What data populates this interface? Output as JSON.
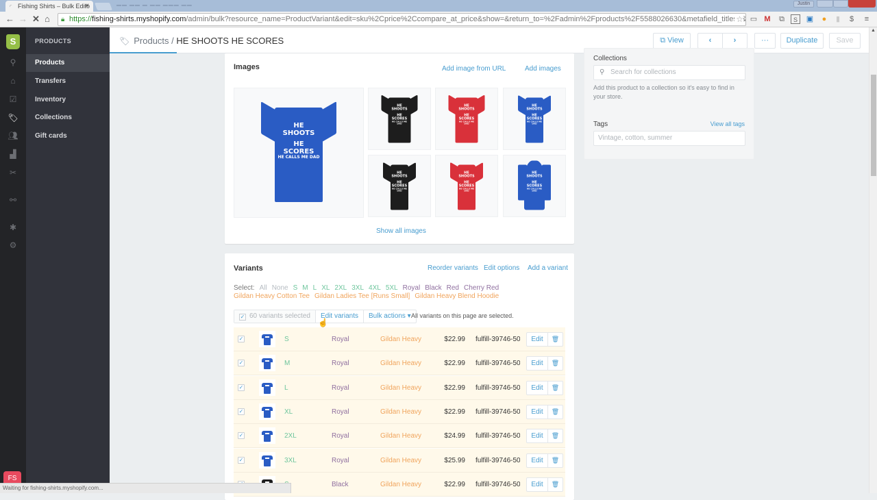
{
  "browser": {
    "tab_title": "Fishing Shirts – Bulk Edito",
    "url_scheme": "https://",
    "url_host": "fishing-shirts.myshopify.com",
    "url_path": "/admin/bulk?resource_name=ProductVariant&edit=sku%2Cprice%2Ccompare_at_price&show=&return_to=%2Fadmin%2Fproducts%2F5588026630&metafield_titles=&m",
    "user_button": "Justin",
    "status_text": "Waiting for fishing-shirts.myshopify.com..."
  },
  "rail": {
    "store_badge": "FS",
    "logo_letter": "S"
  },
  "subnav": {
    "heading": "PRODUCTS",
    "items": [
      {
        "label": "Products",
        "active": true
      },
      {
        "label": "Transfers",
        "active": false
      },
      {
        "label": "Inventory",
        "active": false
      },
      {
        "label": "Collections",
        "active": false
      },
      {
        "label": "Gift cards",
        "active": false
      }
    ]
  },
  "header": {
    "breadcrumb_parent": "Products",
    "separator": " / ",
    "title": "HE SHOOTS HE SCORES",
    "view_label": "View",
    "prev_label": "‹",
    "next_label": "›",
    "more_label": "···",
    "duplicate_label": "Duplicate",
    "save_label": "Save"
  },
  "images": {
    "title": "Images",
    "add_from_url": "Add image from URL",
    "add_images": "Add images",
    "show_all": "Show all images",
    "print_text": [
      "HE SHOOTS",
      "HE SCORES",
      "HE CALLS ME DAD"
    ],
    "items": [
      {
        "color": "#2a5cc4",
        "kind": "tee"
      },
      {
        "color": "#1d1d1d",
        "kind": "tee"
      },
      {
        "color": "#d9313a",
        "kind": "tee"
      },
      {
        "color": "#2a5cc4",
        "kind": "ladies"
      },
      {
        "color": "#1d1d1d",
        "kind": "ladies"
      },
      {
        "color": "#d9313a",
        "kind": "ladies"
      },
      {
        "color": "#2a5cc4",
        "kind": "hoodie"
      }
    ]
  },
  "organization": {
    "collections_label": "Collections",
    "collections_placeholder": "Search for collections",
    "collections_help": "Add this product to a collection so it's easy to find in your store.",
    "tags_label": "Tags",
    "view_all_tags": "View all tags",
    "tags_placeholder": "Vintage, cotton, summer"
  },
  "variants": {
    "title": "Variants",
    "reorder": "Reorder variants",
    "edit_options": "Edit options",
    "add_variant": "Add a variant",
    "select_label": "Select:",
    "select_general": [
      "All",
      "None"
    ],
    "select_sizes": [
      "S",
      "M",
      "L",
      "XL",
      "2XL",
      "3XL",
      "4XL",
      "5XL"
    ],
    "select_colors": [
      "Royal",
      "Black",
      "Red",
      "Cherry Red"
    ],
    "select_styles": [
      "Gildan Heavy Cotton Tee",
      "Gildan Ladies Tee [Runs Small]",
      "Gildan Heavy Blend Hoodie"
    ],
    "selected_count": "60 variants selected",
    "edit_variants": "Edit variants",
    "bulk_actions": "Bulk actions ▾",
    "all_selected_msg": "All variants on this page are selected.",
    "edit_label": "Edit",
    "rows": [
      {
        "size": "S",
        "color": "Royal",
        "style": "Gildan Heavy",
        "price": "$22.99",
        "sku": "fulfill-39746-50",
        "swatch": "#2a5cc4",
        "checked": true
      },
      {
        "size": "M",
        "color": "Royal",
        "style": "Gildan Heavy",
        "price": "$22.99",
        "sku": "fulfill-39746-50",
        "swatch": "#2a5cc4",
        "checked": true
      },
      {
        "size": "L",
        "color": "Royal",
        "style": "Gildan Heavy",
        "price": "$22.99",
        "sku": "fulfill-39746-50",
        "swatch": "#2a5cc4",
        "checked": true
      },
      {
        "size": "XL",
        "color": "Royal",
        "style": "Gildan Heavy",
        "price": "$22.99",
        "sku": "fulfill-39746-50",
        "swatch": "#2a5cc4",
        "checked": true
      },
      {
        "size": "2XL",
        "color": "Royal",
        "style": "Gildan Heavy",
        "price": "$24.99",
        "sku": "fulfill-39746-50",
        "swatch": "#2a5cc4",
        "checked": true
      },
      {
        "size": "3XL",
        "color": "Royal",
        "style": "Gildan Heavy",
        "price": "$25.99",
        "sku": "fulfill-39746-50",
        "swatch": "#2a5cc4",
        "checked": true
      },
      {
        "size": "S",
        "color": "Black",
        "style": "Gildan Heavy",
        "price": "$22.99",
        "sku": "fulfill-39746-50",
        "swatch": "#1d1d1d",
        "checked": true
      }
    ]
  },
  "colors": {
    "accent": "#479ccf",
    "shopify_green": "#95bf47",
    "row_highlight": "#fff9ea"
  }
}
